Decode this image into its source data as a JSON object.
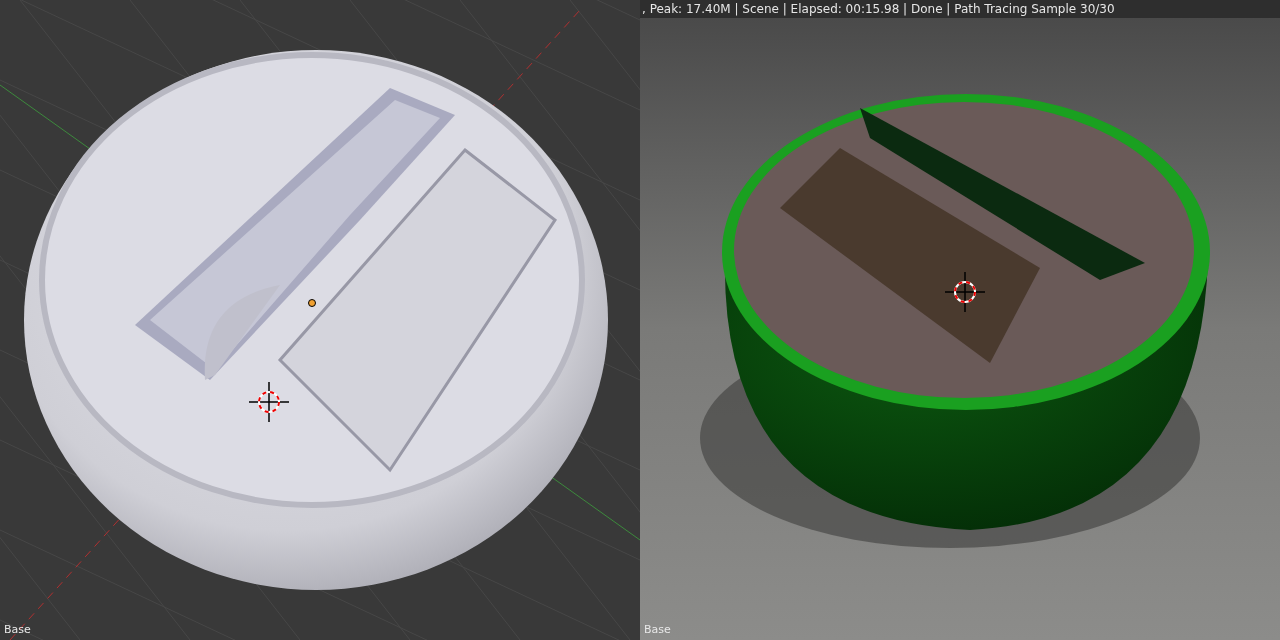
{
  "viewports": [
    {
      "kind": "solid",
      "label": "Base"
    },
    {
      "kind": "rendered",
      "header": ", Peak: 17.40M | Scene | Elapsed: 00:15.98 | Done | Path Tracing Sample 30/30",
      "label": "Base"
    }
  ]
}
